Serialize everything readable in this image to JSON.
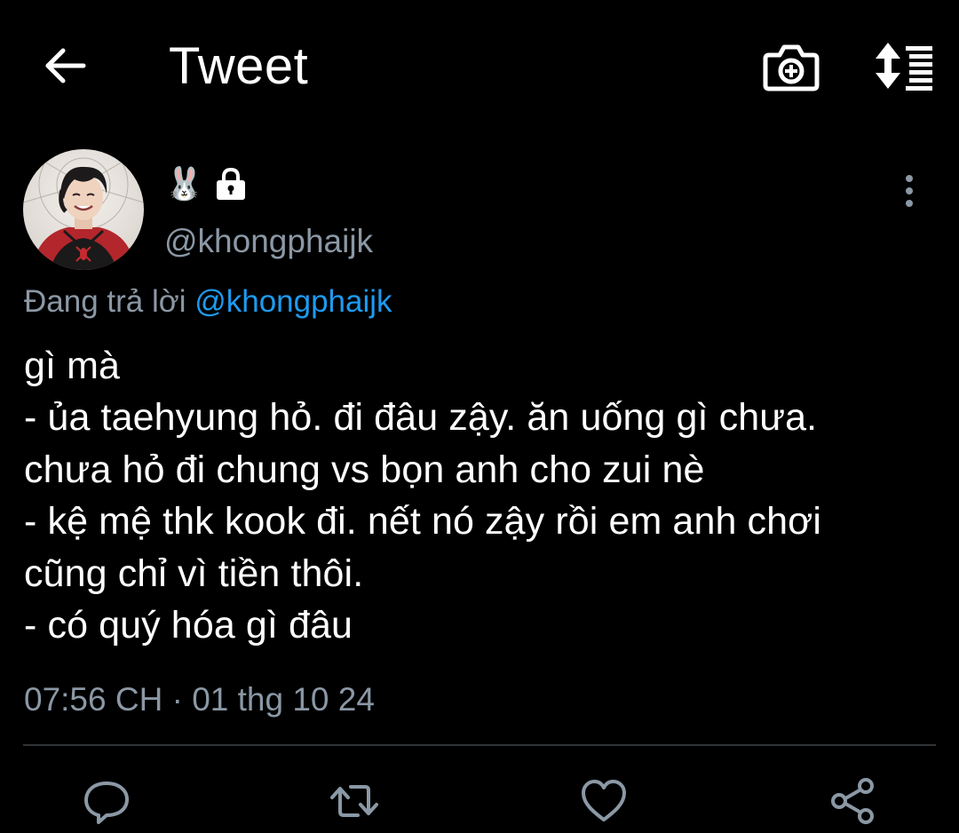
{
  "header": {
    "title": "Tweet",
    "back_icon": "arrow-left-icon",
    "camera_icon": "camera-plus-icon",
    "sort_icon": "sort-list-icon"
  },
  "author": {
    "display_name_emoji": "🐰",
    "lock_icon": "lock-icon",
    "handle": "@khongphaijk",
    "avatar": "avatar-photo",
    "more_icon": "more-vertical-icon"
  },
  "reply": {
    "prefix": "Đang trả lời ",
    "mention": "@khongphaijk"
  },
  "tweet": {
    "text": "gì mà\n- ủa taehyung hỏ. đi đâu zậy. ăn uống gì chưa.\nchưa hỏ đi chung vs bọn anh cho zui nè\n- kệ mệ thk kook đi. nết nó zậy rồi em anh chơi\ncũng chỉ vì tiền thôi.\n- có quý hóa gì đâu",
    "timestamp": "07:56 CH · 01 thg 10 24"
  },
  "actions": {
    "reply_icon": "reply-bubble-icon",
    "retweet_icon": "retweet-icon",
    "like_icon": "heart-icon",
    "share_icon": "share-icon"
  },
  "colors": {
    "background": "#000000",
    "text": "#ffffff",
    "secondary": "#8b98a5",
    "accent": "#1d9bf0",
    "divider": "#2f3336"
  }
}
